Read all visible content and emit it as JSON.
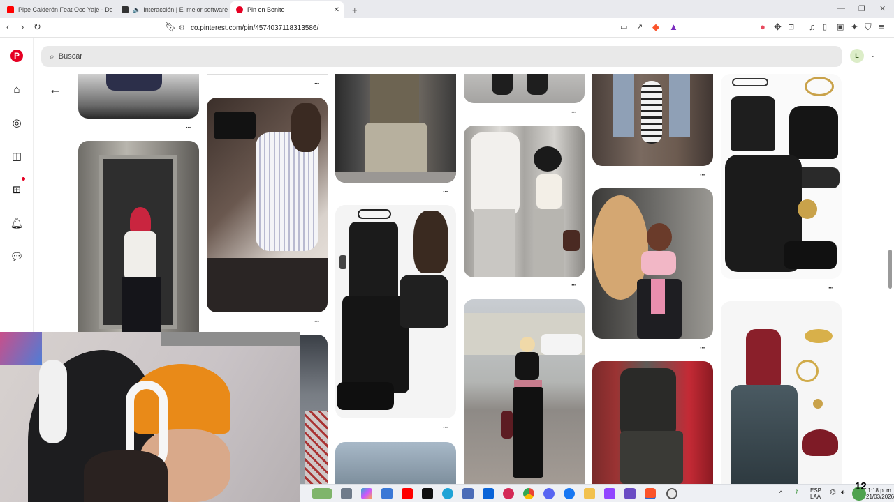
{
  "browser": {
    "tabs": [
      {
        "label": "Pipe Calderón Feat Oco Yajé - De Re",
        "favicon_color": "#ff0000",
        "active": false
      },
      {
        "label": "Interacción | El mejor software p",
        "favicon_color": "#333333",
        "active": false
      },
      {
        "label": "Pin en Benito",
        "favicon_color": "#e60023",
        "active": true
      }
    ],
    "new_tab_label": "+",
    "url": "co.pinterest.com/pin/4574037118313586/",
    "accent": "#e60023"
  },
  "pinterest": {
    "search_placeholder": "Buscar",
    "avatar_initial": "L",
    "nav_icons": [
      "pinterest-logo",
      "home-icon",
      "explore-icon",
      "boards-icon",
      "create-icon",
      "notifications-icon",
      "messages-icon"
    ],
    "more_label": "···"
  },
  "taskbar": {
    "language": "ESP",
    "layout": "LAA",
    "time": "1:18 p. m.",
    "date": "21/03/2026",
    "badge": "12"
  }
}
